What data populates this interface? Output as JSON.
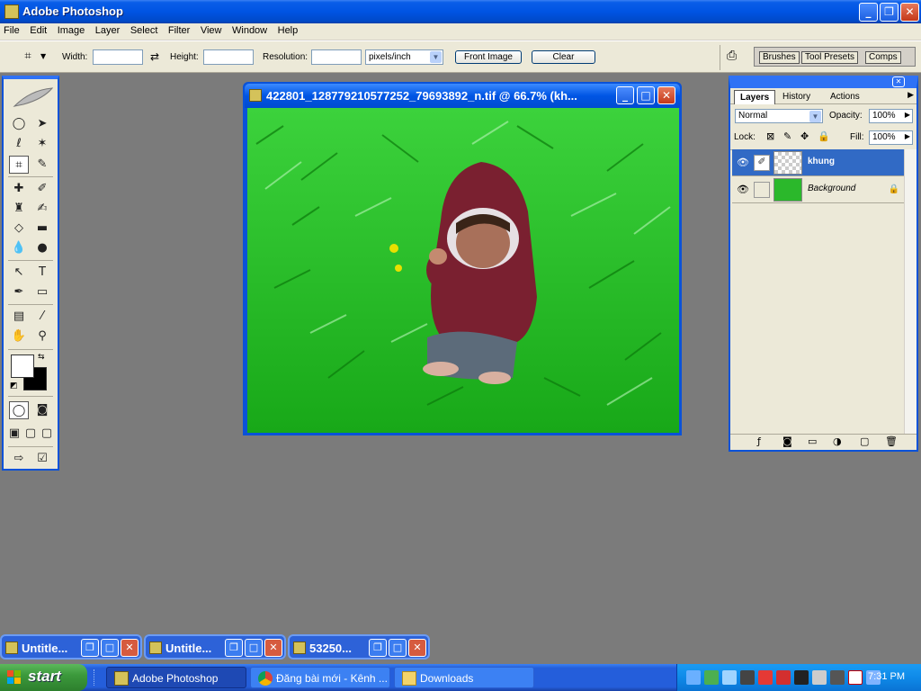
{
  "window": {
    "title": "Adobe Photoshop"
  },
  "menu": [
    "File",
    "Edit",
    "Image",
    "Layer",
    "Select",
    "Filter",
    "View",
    "Window",
    "Help"
  ],
  "options": {
    "width_label": "Width:",
    "height_label": "Height:",
    "resolution_label": "Resolution:",
    "width_value": "",
    "height_value": "",
    "resolution_value": "",
    "units": "pixels/inch",
    "front_image": "Front Image",
    "clear": "Clear",
    "well_tabs": [
      "Brushes",
      "Tool Presets",
      "Comps"
    ]
  },
  "document": {
    "title": "422801_128779210577252_79693892_n.tif @ 66.7% (kh..."
  },
  "layers_panel": {
    "tabs": [
      "Layers",
      "History",
      "Actions"
    ],
    "blend_mode": "Normal",
    "opacity_label": "Opacity:",
    "opacity": "100%",
    "lock_label": "Lock:",
    "fill_label": "Fill:",
    "fill": "100%",
    "layers": [
      {
        "name": "khung",
        "selected": true
      },
      {
        "name": "Background",
        "selected": false
      }
    ]
  },
  "minimized_docs": [
    {
      "title": "Untitle..."
    },
    {
      "title": "Untitle..."
    },
    {
      "title": "53250..."
    }
  ],
  "taskbar": {
    "start": "start",
    "items": [
      "Adobe Photoshop",
      "Đăng bài mới - Kênh ...",
      "Downloads"
    ],
    "time": "7:31 PM"
  },
  "colors": {
    "accent": "#0a52d8",
    "selection": "#316ac5",
    "desktop": "#7b7b7b"
  }
}
